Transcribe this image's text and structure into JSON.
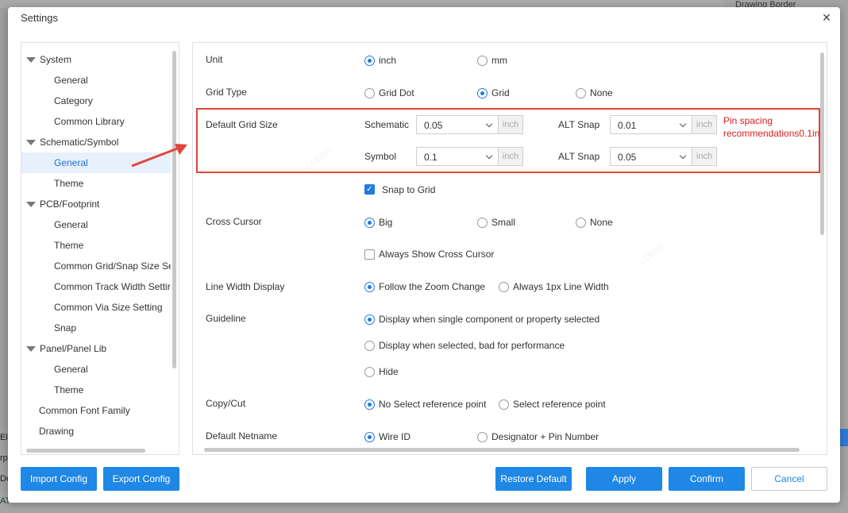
{
  "background": {
    "right_panel_title": "Drawing Border",
    "bottom_row": [
      "AT",
      "Ele",
      "rpe",
      "De"
    ]
  },
  "dialog": {
    "title": "Settings",
    "close_icon": "close-icon"
  },
  "tree": {
    "items": [
      {
        "label": "System",
        "level": 0,
        "expanded": true
      },
      {
        "label": "General",
        "level": 1
      },
      {
        "label": "Category",
        "level": 1
      },
      {
        "label": "Common Library",
        "level": 1
      },
      {
        "label": "Schematic/Symbol",
        "level": 0,
        "expanded": true
      },
      {
        "label": "General",
        "level": 1,
        "selected": true
      },
      {
        "label": "Theme",
        "level": 1
      },
      {
        "label": "PCB/Footprint",
        "level": 0,
        "expanded": true
      },
      {
        "label": "General",
        "level": 1
      },
      {
        "label": "Theme",
        "level": 1
      },
      {
        "label": "Common Grid/Snap Size Se",
        "level": 1
      },
      {
        "label": "Common Track Width Settir",
        "level": 1
      },
      {
        "label": "Common Via Size Setting",
        "level": 1
      },
      {
        "label": "Snap",
        "level": 1
      },
      {
        "label": "Panel/Panel Lib",
        "level": 0,
        "expanded": true
      },
      {
        "label": "General",
        "level": 1
      },
      {
        "label": "Theme",
        "level": 1
      },
      {
        "label": "Common Font Family",
        "level": 0
      },
      {
        "label": "Drawing",
        "level": 0
      }
    ]
  },
  "settings": {
    "unit": {
      "label": "Unit",
      "options": [
        "inch",
        "mm"
      ],
      "selected": "inch"
    },
    "grid_type": {
      "label": "Grid Type",
      "options": [
        "Grid Dot",
        "Grid",
        "None"
      ],
      "selected": "Grid"
    },
    "default_grid_size": {
      "label": "Default Grid Size",
      "schematic_label": "Schematic",
      "schematic_value": "0.05",
      "symbol_label": "Symbol",
      "symbol_value": "0.1",
      "alt_snap_label": "ALT Snap",
      "schematic_alt_value": "0.01",
      "symbol_alt_value": "0.05",
      "unit": "inch",
      "note": "Pin spacing recommendations0.1in"
    },
    "snap_to_grid": {
      "label": "Snap to Grid",
      "checked": true
    },
    "cross_cursor": {
      "label": "Cross Cursor",
      "options": [
        "Big",
        "Small",
        "None"
      ],
      "selected": "Big"
    },
    "always_show_cross_cursor": {
      "label": "Always Show Cross Cursor",
      "checked": false
    },
    "line_width_display": {
      "label": "Line Width Display",
      "options": [
        "Follow the Zoom Change",
        "Always 1px Line Width"
      ],
      "selected": "Follow the Zoom Change"
    },
    "guideline": {
      "label": "Guideline",
      "options": [
        "Display when single component or property selected",
        "Display when selected, bad for performance",
        "Hide"
      ],
      "selected": "Display when single component or property selected"
    },
    "copy_cut": {
      "label": "Copy/Cut",
      "options": [
        "No Select reference point",
        "Select reference point"
      ],
      "selected": "No Select reference point"
    },
    "default_netname": {
      "label": "Default Netname",
      "options": [
        "Wire ID",
        "Designator + Pin Number"
      ],
      "selected": "Wire ID"
    }
  },
  "buttons": {
    "import": "Import Config",
    "export": "Export Config",
    "restore": "Restore Default",
    "apply": "Apply",
    "confirm": "Confirm",
    "cancel": "Cancel"
  },
  "colors": {
    "accent": "#1f87e5",
    "highlight_border": "#e0463c",
    "note": "#d42020"
  }
}
